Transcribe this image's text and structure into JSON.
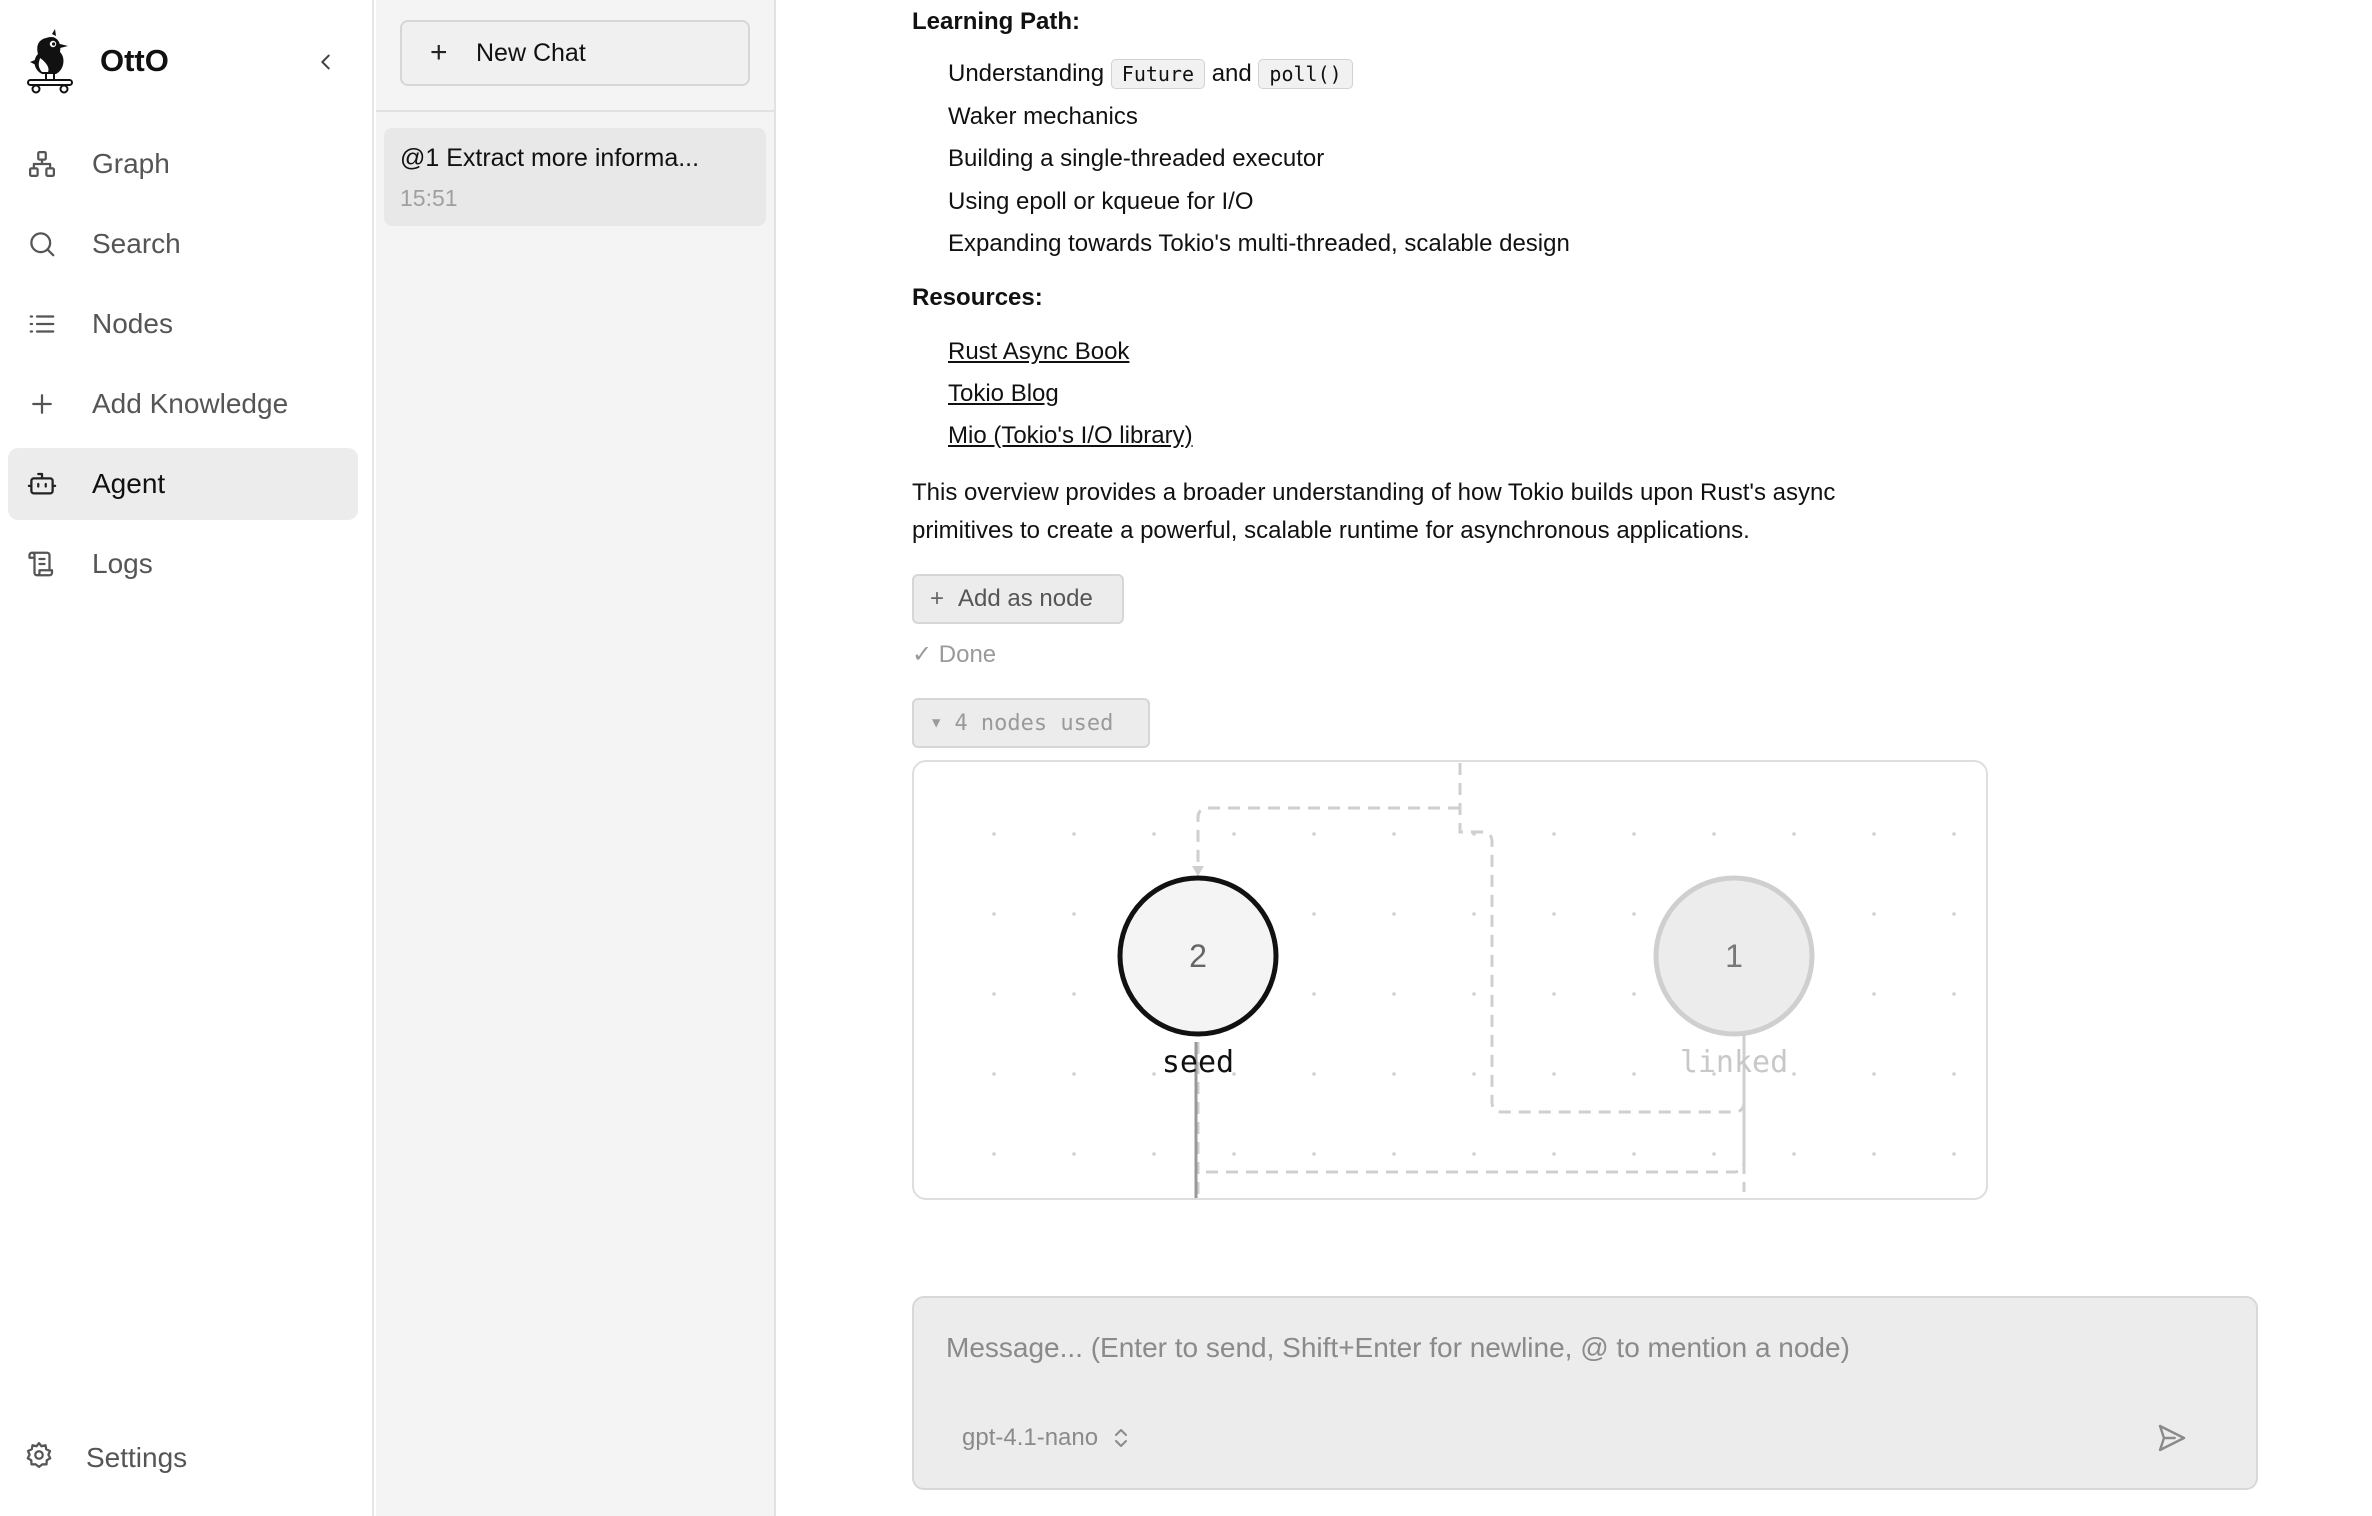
{
  "app": {
    "name": "OttO"
  },
  "sidebar": {
    "items": [
      {
        "label": "Graph",
        "icon": "graph-icon"
      },
      {
        "label": "Search",
        "icon": "search-icon"
      },
      {
        "label": "Nodes",
        "icon": "list-icon"
      },
      {
        "label": "Add Knowledge",
        "icon": "plus-icon"
      },
      {
        "label": "Agent",
        "icon": "robot-icon",
        "active": true
      },
      {
        "label": "Logs",
        "icon": "scroll-icon"
      }
    ],
    "settings_label": "Settings"
  },
  "chats": {
    "new_chat_label": "New Chat",
    "items": [
      {
        "title": "@1 Extract more informa...",
        "time": "15:51"
      }
    ]
  },
  "message": {
    "learning_path_heading": "Learning Path:",
    "learning_path": {
      "item1_prefix": "Understanding",
      "item1_code1": "Future",
      "item1_mid": "and",
      "item1_code2": "poll()",
      "item2": "Waker mechanics",
      "item3": "Building a single-threaded executor",
      "item4": "Using epoll or kqueue for I/O",
      "item5": "Expanding towards Tokio's multi-threaded, scalable design"
    },
    "resources_heading": "Resources:",
    "resources": [
      "Rust Async Book",
      "Tokio Blog",
      "Mio (Tokio's I/O library)"
    ],
    "summary_line1": "This overview provides a broader understanding of how Tokio builds upon Rust's async",
    "summary_line2": "primitives to create a powerful, scalable runtime for asynchronous applications.",
    "add_as_node_label": "Add as node",
    "done_label": "✓ Done",
    "nodes_used_label": "4 nodes used"
  },
  "graph": {
    "nodes": [
      {
        "id": "2",
        "label": "seed",
        "role": "seed"
      },
      {
        "id": "1",
        "label": "linked",
        "role": "linked"
      }
    ]
  },
  "composer": {
    "placeholder": "Message... (Enter to send, Shift+Enter for newline, @ to mention a node)",
    "model": "gpt-4.1-nano"
  },
  "colors": {
    "sidebar_active_bg": "#ececec",
    "chat_column_bg": "#f4f4f4",
    "composer_bg": "#ececec",
    "muted_text": "#8a8a8a"
  }
}
